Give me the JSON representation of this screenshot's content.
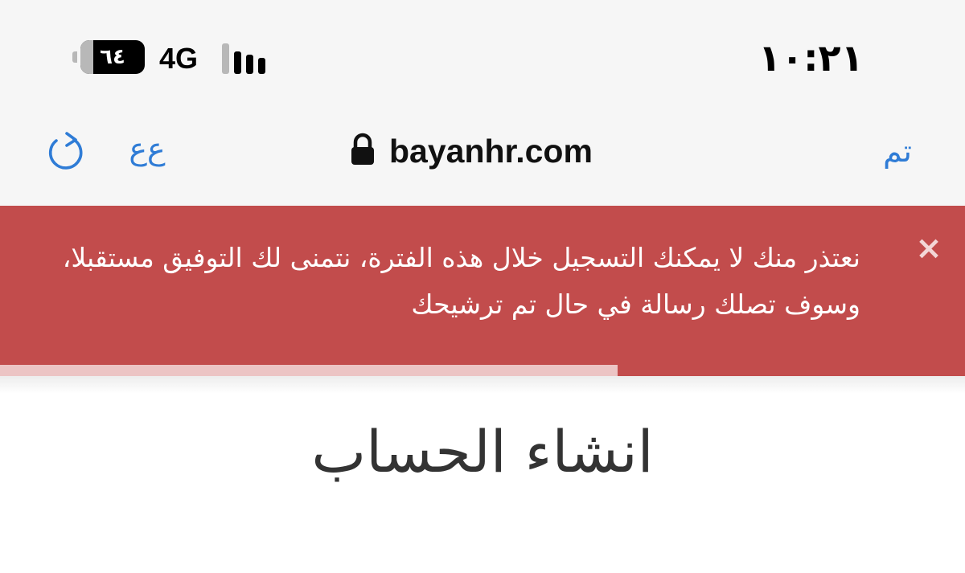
{
  "status_bar": {
    "time": "١٠:٢١",
    "battery_text": "٦٤",
    "battery_level": 0.64,
    "network": "4G",
    "signal_bars": 3,
    "signal_bars_total": 4
  },
  "address_bar": {
    "url": "bayanhr.com",
    "done_label": "تم",
    "text_size_label": "ﻉﻉ",
    "reload_icon": "reload-icon",
    "lock_icon": "lock-icon"
  },
  "alert": {
    "message": "نعتذر منك لا يمكنك التسجيل خلال هذه الفترة، نتمنى لك التوفيق مستقبلا، وسوف تصلك رسالة في حال تم ترشيحك",
    "close_label": "×",
    "progress": 0.64,
    "background_color": "#c24c4c"
  },
  "page": {
    "title": "انشاء الحساب"
  },
  "colors": {
    "accent": "#2f7cd6",
    "alert": "#c24c4c",
    "heading": "#333333"
  }
}
